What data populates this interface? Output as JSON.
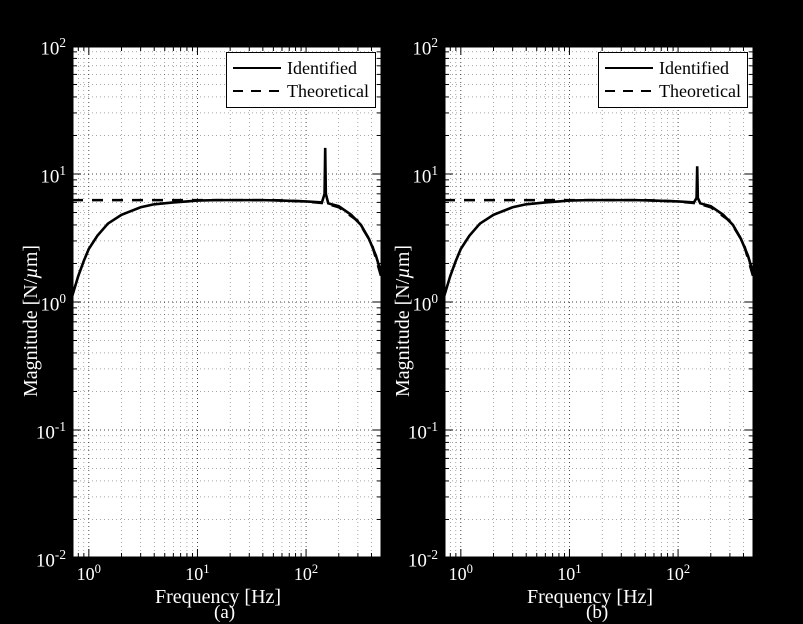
{
  "chart_data": [
    {
      "type": "line",
      "title": "",
      "subtitle_a": "(a)",
      "xlabel": "Frequency [Hz]",
      "ylabel": "Magnitude [N/µm]",
      "xscale": "log",
      "xlim": [
        0.7,
        500
      ],
      "ylim": [
        0.01,
        100
      ],
      "xticks": [
        1,
        10,
        100
      ],
      "xticklabels": [
        "10^0",
        "10^1",
        "10^2"
      ],
      "yticks": [
        0.01,
        0.1,
        1,
        10,
        100
      ],
      "yticklabels": [
        "10^{-2}",
        "10^{-1}",
        "10^{0}",
        "10^{1}",
        "10^{2}"
      ],
      "legend": [
        "Identified",
        "Theoretical"
      ],
      "series": [
        {
          "name": "Identified",
          "style": "solid",
          "x": [
            0.7,
            0.8,
            0.9,
            1,
            1.2,
            1.5,
            2,
            3,
            4,
            6,
            8,
            10,
            15,
            20,
            30,
            40,
            60,
            80,
            100,
            140,
            148,
            150,
            152,
            160,
            200,
            260,
            320,
            380,
            440,
            500
          ],
          "y": [
            1.1,
            1.6,
            2.1,
            2.6,
            3.3,
            4.1,
            4.8,
            5.5,
            5.8,
            6.0,
            6.1,
            6.2,
            6.25,
            6.25,
            6.25,
            6.25,
            6.2,
            6.15,
            6.1,
            6.0,
            7.0,
            16.0,
            7.0,
            5.9,
            5.6,
            4.8,
            4.0,
            3.1,
            2.3,
            1.6
          ]
        },
        {
          "name": "Theoretical",
          "style": "dash",
          "x": [
            0.7,
            1,
            2,
            5,
            10,
            20,
            50,
            100,
            150,
            200,
            300,
            400,
            500
          ],
          "y": [
            6.25,
            6.25,
            6.25,
            6.25,
            6.25,
            6.25,
            6.25,
            6.1,
            5.9,
            5.5,
            4.3,
            2.9,
            1.5
          ]
        }
      ]
    },
    {
      "type": "line",
      "title": "",
      "subtitle_b": "(b)",
      "xlabel": "Frequency [Hz]",
      "ylabel": "Magnitude [N/µm]",
      "xscale": "log",
      "xlim": [
        0.7,
        500
      ],
      "ylim": [
        0.01,
        100
      ],
      "xticks": [
        1,
        10,
        100
      ],
      "xticklabels": [
        "10^0",
        "10^1",
        "10^2"
      ],
      "yticks": [
        0.01,
        0.1,
        1,
        10,
        100
      ],
      "yticklabels": [
        "10^{-2}",
        "10^{-1}",
        "10^{0}",
        "10^{1}",
        "10^{2}"
      ],
      "legend": [
        "Identified",
        "Theoretical"
      ],
      "series": [
        {
          "name": "Identified",
          "style": "solid",
          "x": [
            0.7,
            0.8,
            0.9,
            1,
            1.2,
            1.5,
            2,
            3,
            4,
            6,
            8,
            10,
            15,
            20,
            30,
            40,
            60,
            80,
            100,
            140,
            148,
            150,
            152,
            160,
            200,
            260,
            320,
            380,
            440,
            500
          ],
          "y": [
            1.1,
            1.6,
            2.1,
            2.6,
            3.3,
            4.1,
            4.8,
            5.5,
            5.8,
            6.0,
            6.1,
            6.2,
            6.25,
            6.25,
            6.25,
            6.25,
            6.2,
            6.15,
            6.1,
            6.0,
            6.5,
            11.5,
            6.5,
            5.9,
            5.6,
            4.8,
            4.0,
            3.1,
            2.3,
            1.6
          ]
        },
        {
          "name": "Theoretical",
          "style": "dash",
          "x": [
            0.7,
            1,
            2,
            5,
            10,
            20,
            50,
            100,
            150,
            200,
            300,
            400,
            500
          ],
          "y": [
            6.25,
            6.25,
            6.25,
            6.25,
            6.25,
            6.25,
            6.25,
            6.1,
            5.9,
            5.5,
            4.3,
            2.9,
            1.5
          ]
        }
      ]
    }
  ]
}
